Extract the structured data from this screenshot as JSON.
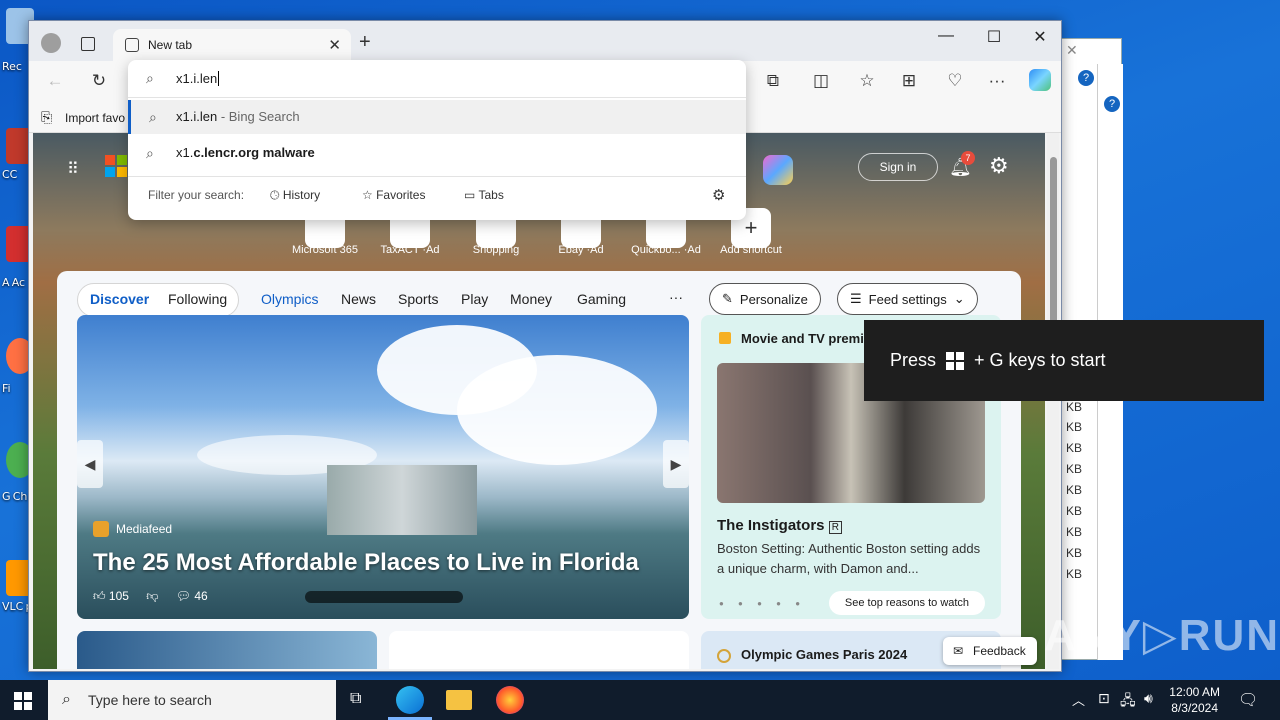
{
  "desktop": {
    "icons": [
      {
        "label": "Rec"
      },
      {
        "label": "CC"
      },
      {
        "label": "A Ac"
      },
      {
        "label": "Fi"
      },
      {
        "label": "G Ch"
      },
      {
        "label": "VLC p"
      }
    ]
  },
  "explorer_bg": {
    "sizes": [
      "KB",
      "KB",
      "KB",
      "KB",
      "KB",
      "KB",
      "KB",
      "KB",
      "KB",
      "KB",
      "KB"
    ]
  },
  "browser": {
    "tab_title": "New tab",
    "favorites_bar_text": "Import favo",
    "omnibox": {
      "query": "x1.i.len",
      "suggestions": [
        {
          "text": "x1.i.len",
          "suffix": " - Bing Search"
        },
        {
          "prefix": "x1.",
          "bold": "c.len",
          "rest": "cr.org malware"
        }
      ],
      "filter_label": "Filter your search:",
      "filters": [
        "History",
        "Favorites",
        "Tabs"
      ]
    },
    "page": {
      "sign_in": "Sign in",
      "notification_count": "7",
      "shortcuts": [
        {
          "label": "Microsoft 365"
        },
        {
          "label": "TaxACT ·Ad"
        },
        {
          "label": "Shopping"
        },
        {
          "label": "Ebay ·Ad"
        },
        {
          "label": "Quickbo... ·Ad"
        },
        {
          "label": "Add shortcut"
        }
      ],
      "nav": {
        "discover": "Discover",
        "following": "Following",
        "items": [
          "Olympics",
          "News",
          "Sports",
          "Play",
          "Money",
          "Gaming"
        ],
        "more": "···",
        "personalize": "Personalize",
        "feed_settings": "Feed settings"
      },
      "hero": {
        "source": "Mediafeed",
        "title": "The 25 Most Affordable Places to Live in Florida",
        "likes": "105",
        "comments": "46"
      },
      "side": {
        "heading": "Movie and TV premi",
        "title": "The Instigators",
        "rating": "R",
        "description": "Boston Setting: Authentic Boston setting adds a unique charm, with Damon and...",
        "button": "See top reasons to watch"
      },
      "bottom": {
        "olympic": "Olympic Games Paris 2024",
        "feedback": "Feedback"
      }
    }
  },
  "toast": {
    "press": "Press",
    "rest": "+ G keys to start"
  },
  "taskbar": {
    "search_placeholder": "Type here to search",
    "time": "12:00 AM",
    "date": "8/3/2024"
  },
  "watermark": "ANY▷RUN"
}
